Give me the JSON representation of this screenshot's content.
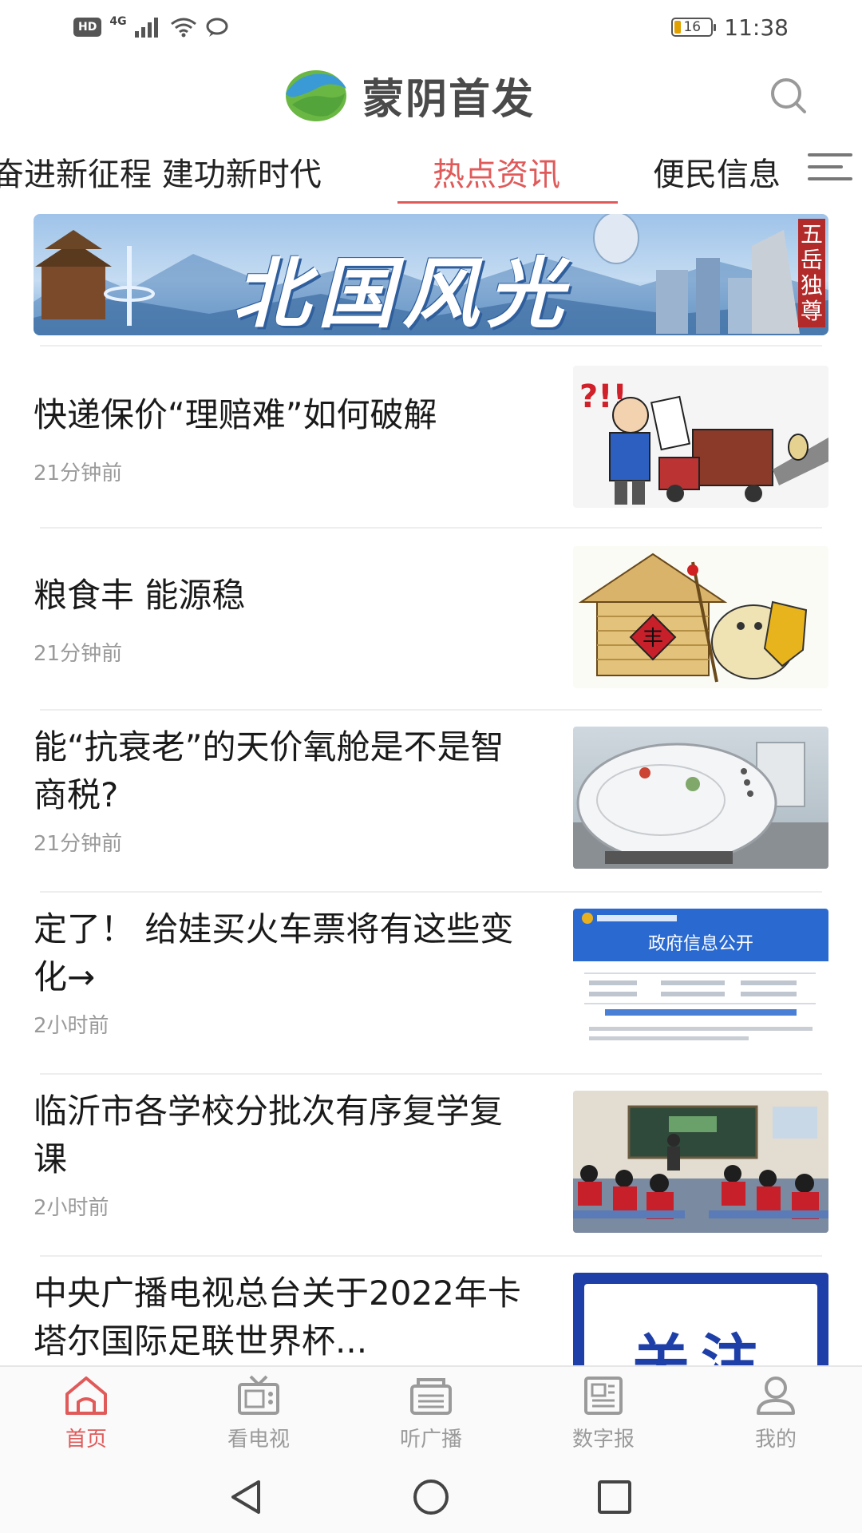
{
  "status_bar": {
    "hd": "HD",
    "network": "4G",
    "time": "11:38",
    "battery": "16"
  },
  "header": {
    "app_name": "蒙阴首发",
    "logo_colors": [
      "#3a9ad6",
      "#6bb744"
    ]
  },
  "tabs": [
    {
      "label": "奋进新征程 建功新时代",
      "active": false
    },
    {
      "label": "热点资讯",
      "active": true
    },
    {
      "label": "便民信息",
      "active": false
    }
  ],
  "accent_color": "#e05a5a",
  "banner": {
    "title": "北国风光",
    "side_text": "五岳独尊"
  },
  "feed": [
    {
      "title": "快递保价“理赔难”如何破解",
      "time": "21分钟前",
      "image": "cartoon-courier-claim"
    },
    {
      "title": "粮食丰 能源稳",
      "time": "21分钟前",
      "image": "cartoon-granary"
    },
    {
      "title": "能“抗衰老”的天价氧舱是不是智商税?",
      "time": "21分钟前",
      "image": "oxygen-chamber-photo"
    },
    {
      "title": "定了！ 给娃买火车票将有这些变化→",
      "time": "2小时前",
      "image": "gov-info-document",
      "thumb_heading": "政府信息公开"
    },
    {
      "title": "临沂市各学校分批次有序复学复课",
      "time": "2小时前",
      "image": "classroom-photo"
    },
    {
      "title": "中央广播电视总台关于2022年卡塔尔国际足联世界杯...",
      "time": "",
      "image": "follow-poster",
      "thumb_heading": "关注"
    }
  ],
  "bottom_nav": [
    {
      "label": "首页",
      "icon": "home-icon",
      "active": true
    },
    {
      "label": "看电视",
      "icon": "tv-icon",
      "active": false
    },
    {
      "label": "听广播",
      "icon": "radio-icon",
      "active": false
    },
    {
      "label": "数字报",
      "icon": "newspaper-icon",
      "active": false
    },
    {
      "label": "我的",
      "icon": "user-icon",
      "active": false
    }
  ]
}
